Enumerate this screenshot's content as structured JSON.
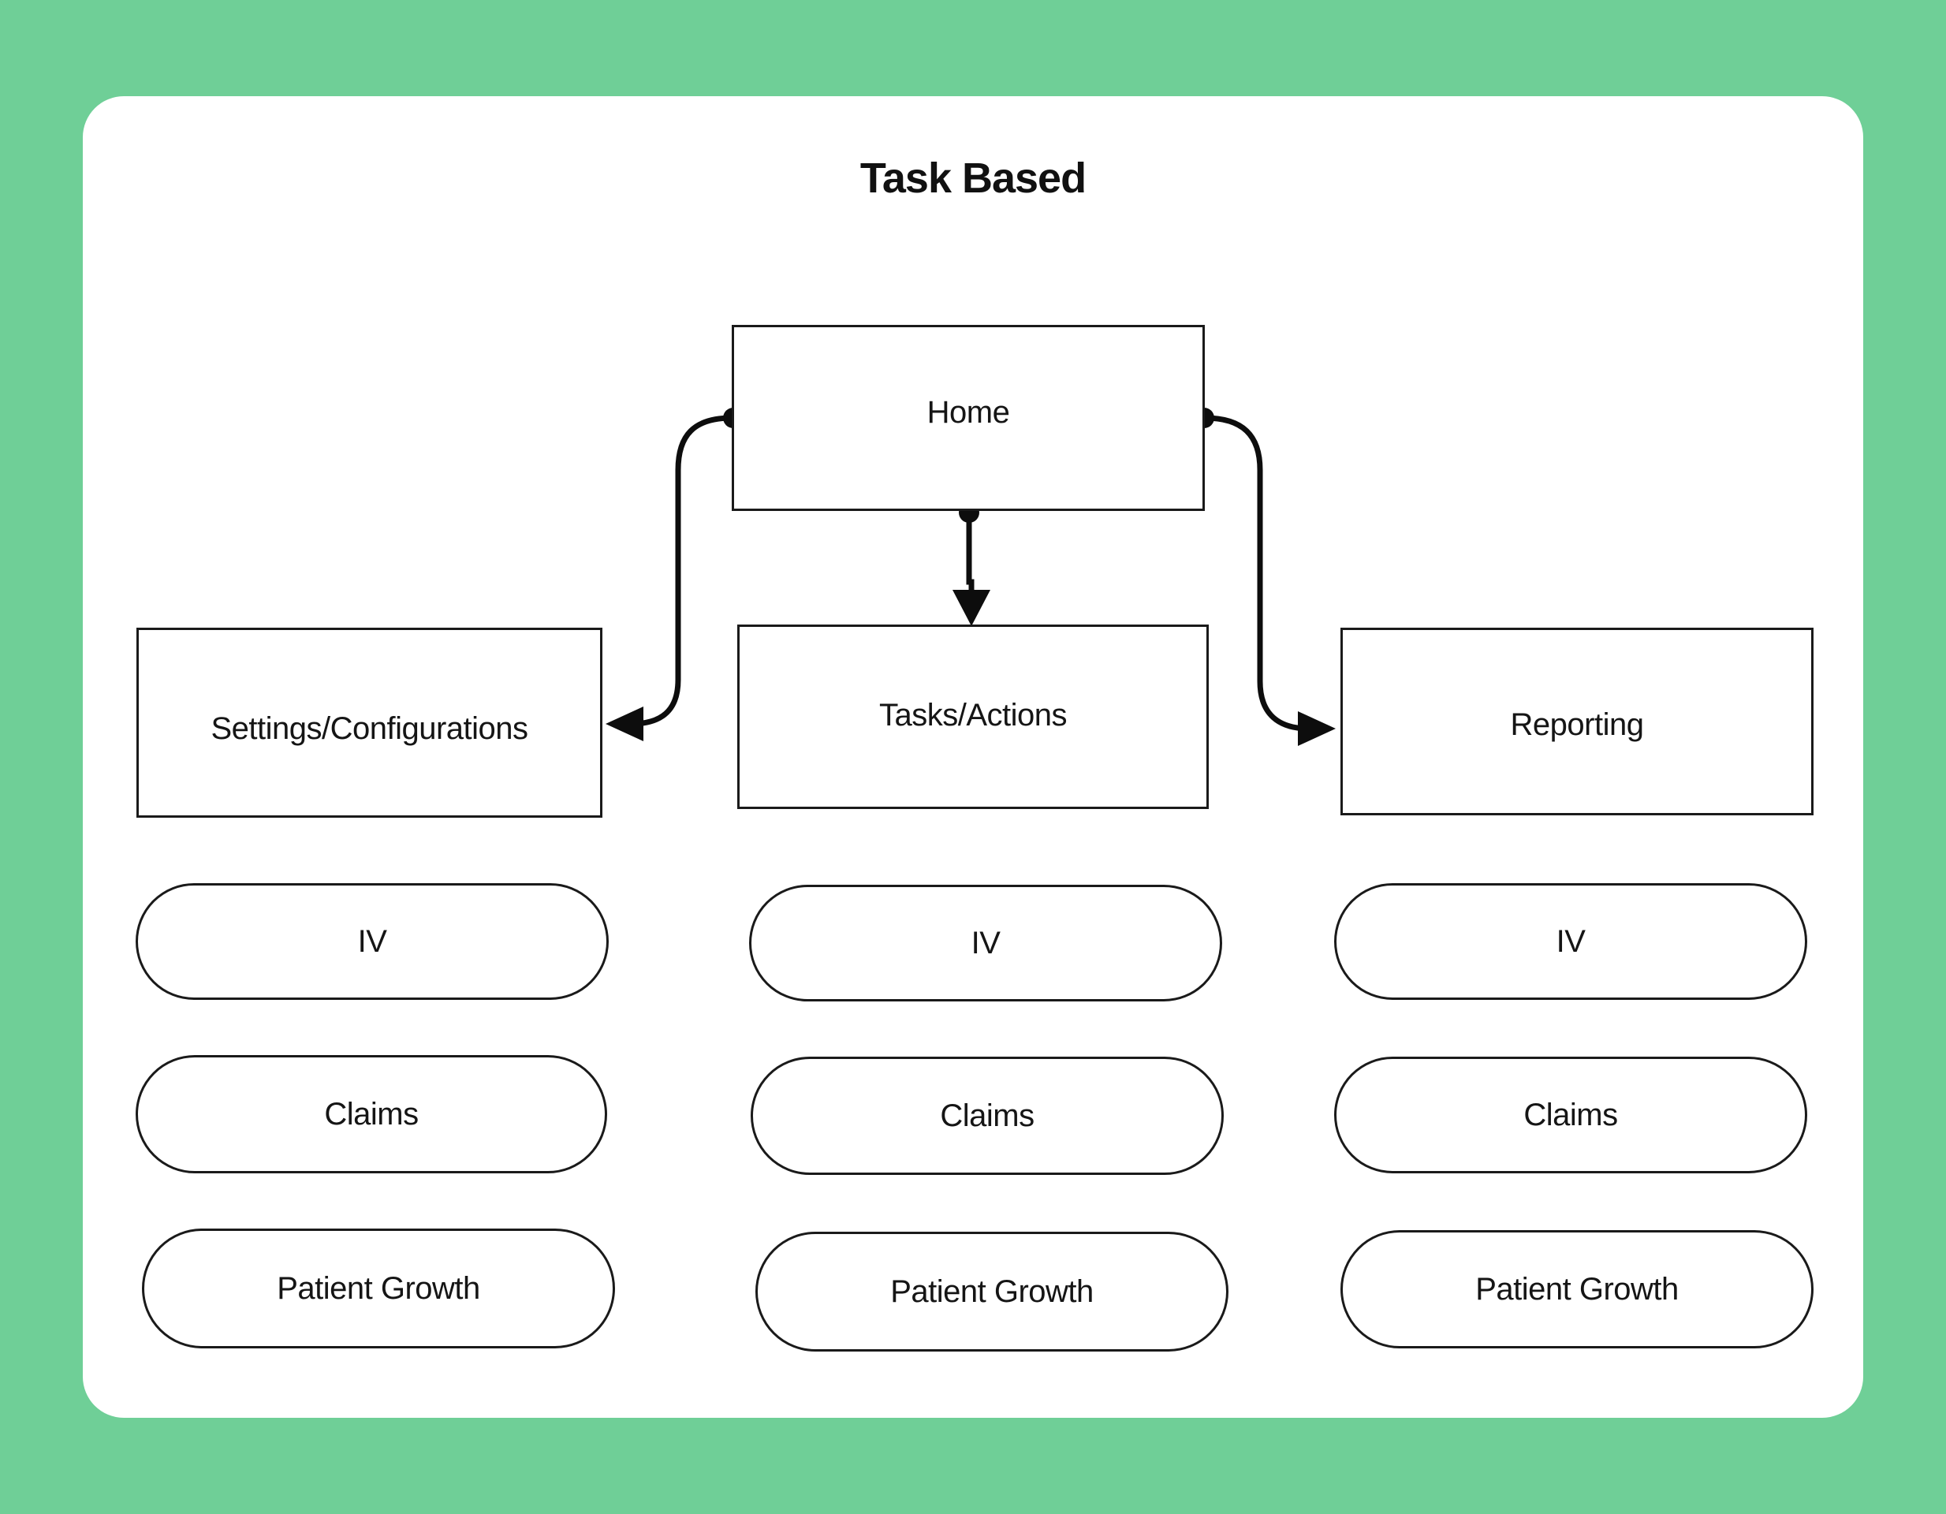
{
  "page": {
    "background_color": "#6FCF97",
    "card_color": "#ffffff",
    "stroke_color": "#0d0d0d"
  },
  "title": "Task Based",
  "diagram": {
    "root": {
      "id": "home",
      "label": "Home",
      "shape": "rectangle"
    },
    "branches": [
      {
        "id": "settings",
        "label": "Settings/Configurations",
        "shape": "rectangle",
        "column": "left",
        "edge_from": "home",
        "edge_style": "curved-arrow",
        "arrow_direction": "left",
        "children": [
          {
            "id": "left-iv",
            "label": "IV",
            "shape": "pill"
          },
          {
            "id": "left-claims",
            "label": "Claims",
            "shape": "pill"
          },
          {
            "id": "left-growth",
            "label": "Patient Growth",
            "shape": "pill"
          }
        ]
      },
      {
        "id": "tasks",
        "label": "Tasks/Actions",
        "shape": "rectangle",
        "column": "middle",
        "edge_from": "home",
        "edge_style": "straight-arrow",
        "arrow_direction": "down",
        "children": [
          {
            "id": "mid-iv",
            "label": "IV",
            "shape": "pill"
          },
          {
            "id": "mid-claims",
            "label": "Claims",
            "shape": "pill"
          },
          {
            "id": "mid-growth",
            "label": "Patient Growth",
            "shape": "pill"
          }
        ]
      },
      {
        "id": "reporting",
        "label": "Reporting",
        "shape": "rectangle",
        "column": "right",
        "edge_from": "home",
        "edge_style": "curved-arrow",
        "arrow_direction": "right",
        "children": [
          {
            "id": "right-iv",
            "label": "IV",
            "shape": "pill"
          },
          {
            "id": "right-claims",
            "label": "Claims",
            "shape": "pill"
          },
          {
            "id": "right-growth",
            "label": "Patient Growth",
            "shape": "pill"
          }
        ]
      }
    ]
  }
}
